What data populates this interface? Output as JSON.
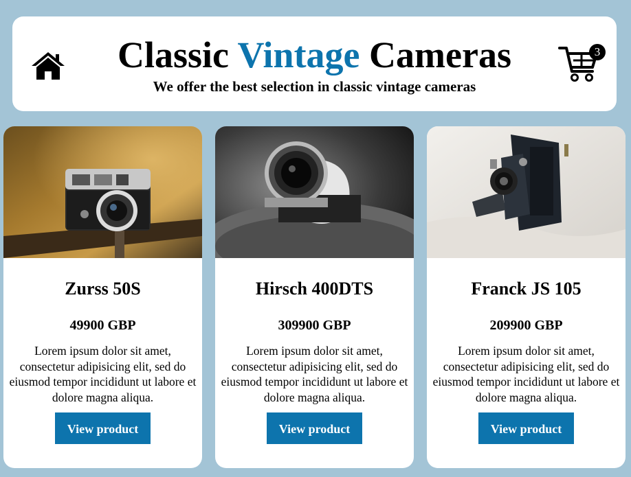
{
  "header": {
    "title_part1": "Classic ",
    "title_part2": "Vintage",
    "title_part3": " Cameras",
    "subtitle": "We offer the best selection in classic vintage cameras",
    "home_icon": "home-icon",
    "cart_icon": "shopping-cart-icon",
    "cart_count": "3",
    "accent_color": "#0d74ad"
  },
  "products": [
    {
      "name": "Zurss 50S",
      "price": "49900 GBP",
      "description": "Lorem ipsum dolor sit amet, consectetur adipisicing elit, sed do eiusmod tempor incididunt ut labore et dolore magna aliqua.",
      "button_label": "View product"
    },
    {
      "name": "Hirsch 400DTS",
      "price": "309900 GBP",
      "description": "Lorem ipsum dolor sit amet, consectetur adipisicing elit, sed do eiusmod tempor incididunt ut labore et dolore magna aliqua.",
      "button_label": "View product"
    },
    {
      "name": "Franck JS 105",
      "price": "209900 GBP",
      "description": "Lorem ipsum dolor sit amet, consectetur adipisicing elit, sed do eiusmod tempor incididunt ut labore et dolore magna aliqua.",
      "button_label": "View product"
    }
  ]
}
